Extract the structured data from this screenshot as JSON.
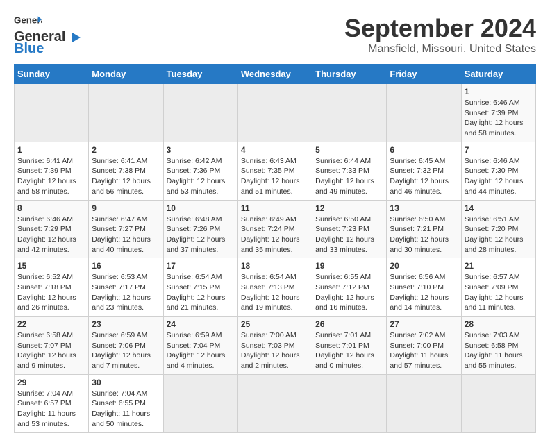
{
  "header": {
    "logo_line1": "General",
    "logo_line2": "Blue",
    "title": "September 2024",
    "subtitle": "Mansfield, Missouri, United States"
  },
  "calendar": {
    "days_of_week": [
      "Sunday",
      "Monday",
      "Tuesday",
      "Wednesday",
      "Thursday",
      "Friday",
      "Saturday"
    ],
    "weeks": [
      [
        {
          "day": "",
          "empty": true
        },
        {
          "day": "",
          "empty": true
        },
        {
          "day": "",
          "empty": true
        },
        {
          "day": "",
          "empty": true
        },
        {
          "day": "",
          "empty": true
        },
        {
          "day": "",
          "empty": true
        },
        {
          "day": "1",
          "sunrise": "Sunrise: 6:46 AM",
          "sunset": "Sunset: 7:39 PM",
          "daylight": "Daylight: 12 hours and 58 minutes."
        }
      ],
      [
        {
          "day": "1",
          "sunrise": "Sunrise: 6:41 AM",
          "sunset": "Sunset: 7:39 PM",
          "daylight": "Daylight: 12 hours and 58 minutes."
        },
        {
          "day": "2",
          "sunrise": "Sunrise: 6:41 AM",
          "sunset": "Sunset: 7:38 PM",
          "daylight": "Daylight: 12 hours and 56 minutes."
        },
        {
          "day": "3",
          "sunrise": "Sunrise: 6:42 AM",
          "sunset": "Sunset: 7:36 PM",
          "daylight": "Daylight: 12 hours and 53 minutes."
        },
        {
          "day": "4",
          "sunrise": "Sunrise: 6:43 AM",
          "sunset": "Sunset: 7:35 PM",
          "daylight": "Daylight: 12 hours and 51 minutes."
        },
        {
          "day": "5",
          "sunrise": "Sunrise: 6:44 AM",
          "sunset": "Sunset: 7:33 PM",
          "daylight": "Daylight: 12 hours and 49 minutes."
        },
        {
          "day": "6",
          "sunrise": "Sunrise: 6:45 AM",
          "sunset": "Sunset: 7:32 PM",
          "daylight": "Daylight: 12 hours and 46 minutes."
        },
        {
          "day": "7",
          "sunrise": "Sunrise: 6:46 AM",
          "sunset": "Sunset: 7:30 PM",
          "daylight": "Daylight: 12 hours and 44 minutes."
        }
      ],
      [
        {
          "day": "8",
          "sunrise": "Sunrise: 6:46 AM",
          "sunset": "Sunset: 7:29 PM",
          "daylight": "Daylight: 12 hours and 42 minutes."
        },
        {
          "day": "9",
          "sunrise": "Sunrise: 6:47 AM",
          "sunset": "Sunset: 7:27 PM",
          "daylight": "Daylight: 12 hours and 40 minutes."
        },
        {
          "day": "10",
          "sunrise": "Sunrise: 6:48 AM",
          "sunset": "Sunset: 7:26 PM",
          "daylight": "Daylight: 12 hours and 37 minutes."
        },
        {
          "day": "11",
          "sunrise": "Sunrise: 6:49 AM",
          "sunset": "Sunset: 7:24 PM",
          "daylight": "Daylight: 12 hours and 35 minutes."
        },
        {
          "day": "12",
          "sunrise": "Sunrise: 6:50 AM",
          "sunset": "Sunset: 7:23 PM",
          "daylight": "Daylight: 12 hours and 33 minutes."
        },
        {
          "day": "13",
          "sunrise": "Sunrise: 6:50 AM",
          "sunset": "Sunset: 7:21 PM",
          "daylight": "Daylight: 12 hours and 30 minutes."
        },
        {
          "day": "14",
          "sunrise": "Sunrise: 6:51 AM",
          "sunset": "Sunset: 7:20 PM",
          "daylight": "Daylight: 12 hours and 28 minutes."
        }
      ],
      [
        {
          "day": "15",
          "sunrise": "Sunrise: 6:52 AM",
          "sunset": "Sunset: 7:18 PM",
          "daylight": "Daylight: 12 hours and 26 minutes."
        },
        {
          "day": "16",
          "sunrise": "Sunrise: 6:53 AM",
          "sunset": "Sunset: 7:17 PM",
          "daylight": "Daylight: 12 hours and 23 minutes."
        },
        {
          "day": "17",
          "sunrise": "Sunrise: 6:54 AM",
          "sunset": "Sunset: 7:15 PM",
          "daylight": "Daylight: 12 hours and 21 minutes."
        },
        {
          "day": "18",
          "sunrise": "Sunrise: 6:54 AM",
          "sunset": "Sunset: 7:13 PM",
          "daylight": "Daylight: 12 hours and 19 minutes."
        },
        {
          "day": "19",
          "sunrise": "Sunrise: 6:55 AM",
          "sunset": "Sunset: 7:12 PM",
          "daylight": "Daylight: 12 hours and 16 minutes."
        },
        {
          "day": "20",
          "sunrise": "Sunrise: 6:56 AM",
          "sunset": "Sunset: 7:10 PM",
          "daylight": "Daylight: 12 hours and 14 minutes."
        },
        {
          "day": "21",
          "sunrise": "Sunrise: 6:57 AM",
          "sunset": "Sunset: 7:09 PM",
          "daylight": "Daylight: 12 hours and 11 minutes."
        }
      ],
      [
        {
          "day": "22",
          "sunrise": "Sunrise: 6:58 AM",
          "sunset": "Sunset: 7:07 PM",
          "daylight": "Daylight: 12 hours and 9 minutes."
        },
        {
          "day": "23",
          "sunrise": "Sunrise: 6:59 AM",
          "sunset": "Sunset: 7:06 PM",
          "daylight": "Daylight: 12 hours and 7 minutes."
        },
        {
          "day": "24",
          "sunrise": "Sunrise: 6:59 AM",
          "sunset": "Sunset: 7:04 PM",
          "daylight": "Daylight: 12 hours and 4 minutes."
        },
        {
          "day": "25",
          "sunrise": "Sunrise: 7:00 AM",
          "sunset": "Sunset: 7:03 PM",
          "daylight": "Daylight: 12 hours and 2 minutes."
        },
        {
          "day": "26",
          "sunrise": "Sunrise: 7:01 AM",
          "sunset": "Sunset: 7:01 PM",
          "daylight": "Daylight: 12 hours and 0 minutes."
        },
        {
          "day": "27",
          "sunrise": "Sunrise: 7:02 AM",
          "sunset": "Sunset: 7:00 PM",
          "daylight": "Daylight: 11 hours and 57 minutes."
        },
        {
          "day": "28",
          "sunrise": "Sunrise: 7:03 AM",
          "sunset": "Sunset: 6:58 PM",
          "daylight": "Daylight: 11 hours and 55 minutes."
        }
      ],
      [
        {
          "day": "29",
          "sunrise": "Sunrise: 7:04 AM",
          "sunset": "Sunset: 6:57 PM",
          "daylight": "Daylight: 11 hours and 53 minutes."
        },
        {
          "day": "30",
          "sunrise": "Sunrise: 7:04 AM",
          "sunset": "Sunset: 6:55 PM",
          "daylight": "Daylight: 11 hours and 50 minutes."
        },
        {
          "day": "",
          "empty": true
        },
        {
          "day": "",
          "empty": true
        },
        {
          "day": "",
          "empty": true
        },
        {
          "day": "",
          "empty": true
        },
        {
          "day": "",
          "empty": true
        }
      ]
    ]
  }
}
